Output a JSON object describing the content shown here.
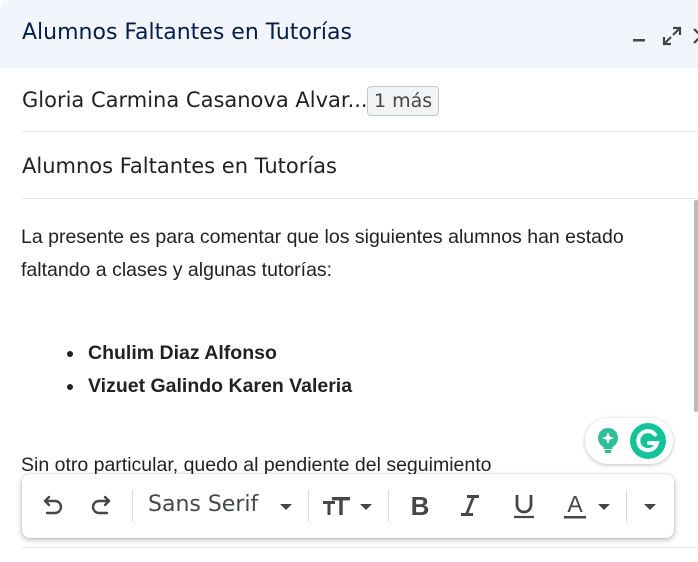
{
  "window": {
    "title": "Alumnos Faltantes en Tutorías",
    "controls": [
      "minimize-icon",
      "expand-icon",
      "close-icon"
    ]
  },
  "recipients": {
    "name": "Gloria Carmina Casanova Alvar...",
    "more_label": "1 más"
  },
  "subject": "Alumnos Faltantes en Tutorías",
  "body": {
    "paragraph": "La presente es para comentar que los siguientes alumnos han estado faltando a clases y algunas tutorías:",
    "students": [
      "Chulim Diaz Alfonso",
      "Vizuet Galindo Karen Valeria"
    ],
    "closing": "Sin otro particular, quedo al pendiente del seguimiento"
  },
  "grammarly": {
    "icons": [
      "lightbulb-icon",
      "grammarly-icon"
    ],
    "colors": {
      "bulb": "#2fbe98",
      "logo": "#15c39a"
    }
  },
  "format_toolbar": {
    "font": "Sans Serif",
    "icons": [
      "undo-icon",
      "redo-icon",
      "font-dropdown-icon",
      "text-size-icon",
      "bold-icon",
      "italic-icon",
      "underline-icon",
      "text-color-icon",
      "more-options-icon"
    ]
  },
  "colors": {
    "title_text": "#041e49",
    "titlebar_bg": "#f2f6fc",
    "body_text": "#222222"
  }
}
